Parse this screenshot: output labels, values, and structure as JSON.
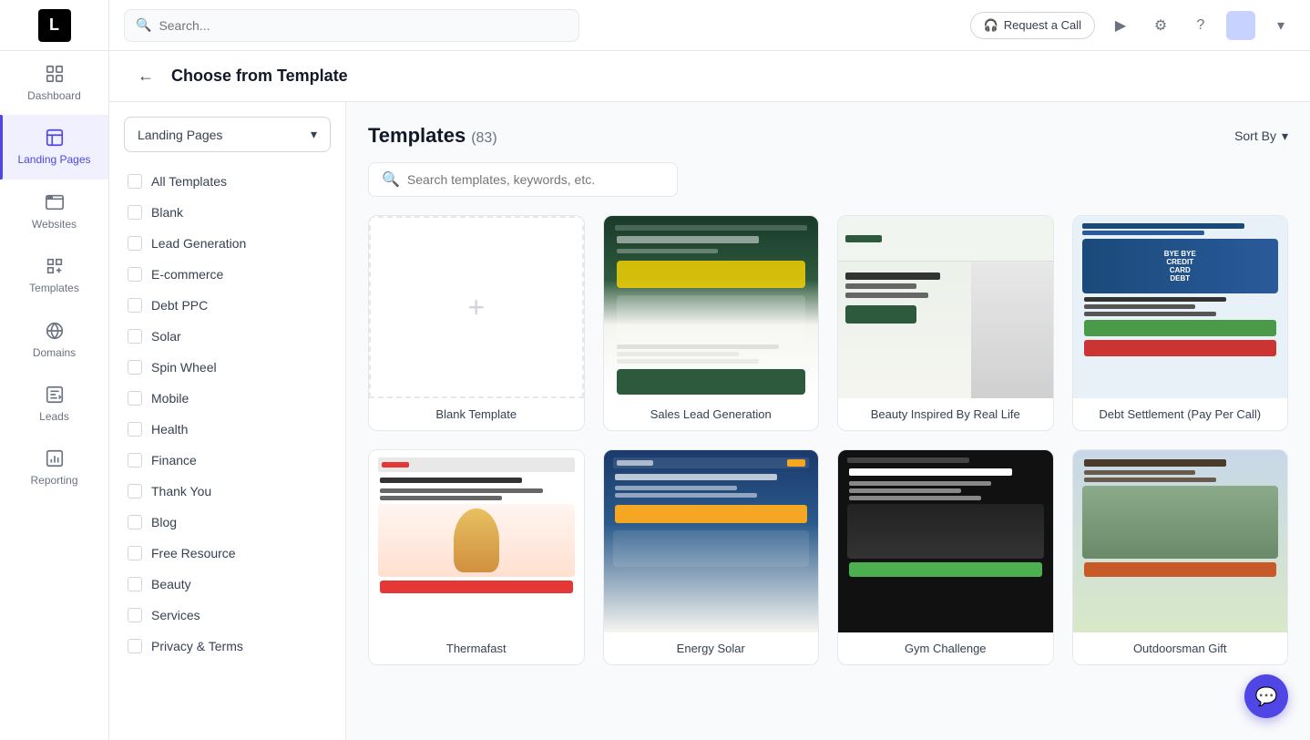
{
  "sidebar": {
    "logo_text": "L",
    "items": [
      {
        "id": "dashboard",
        "label": "Dashboard",
        "icon": "⊞",
        "active": false
      },
      {
        "id": "landing-pages",
        "label": "Landing Pages",
        "icon": "📄",
        "active": true
      },
      {
        "id": "websites",
        "label": "Websites",
        "icon": "🌐",
        "active": false
      },
      {
        "id": "templates",
        "label": "Templates",
        "icon": "🗂",
        "active": false
      },
      {
        "id": "domains",
        "label": "Domains",
        "icon": "🔗",
        "active": false
      },
      {
        "id": "leads",
        "label": "Leads",
        "icon": "📊",
        "active": false
      },
      {
        "id": "reporting",
        "label": "Reporting",
        "icon": "📈",
        "active": false
      }
    ]
  },
  "topbar": {
    "search_placeholder": "Search...",
    "request_call_label": "Request a Call",
    "icons": [
      "▶",
      "⚙",
      "?"
    ]
  },
  "page_header": {
    "back_label": "←",
    "title": "Choose from Template"
  },
  "filter_sidebar": {
    "dropdown_label": "Landing Pages",
    "filters": [
      {
        "id": "all",
        "label": "All Templates"
      },
      {
        "id": "blank",
        "label": "Blank"
      },
      {
        "id": "lead-gen",
        "label": "Lead Generation"
      },
      {
        "id": "ecommerce",
        "label": "E-commerce"
      },
      {
        "id": "debt-ppc",
        "label": "Debt PPC"
      },
      {
        "id": "solar",
        "label": "Solar"
      },
      {
        "id": "spin-wheel",
        "label": "Spin Wheel"
      },
      {
        "id": "mobile",
        "label": "Mobile"
      },
      {
        "id": "health",
        "label": "Health"
      },
      {
        "id": "finance",
        "label": "Finance"
      },
      {
        "id": "thank-you",
        "label": "Thank You"
      },
      {
        "id": "blog",
        "label": "Blog"
      },
      {
        "id": "free-resource",
        "label": "Free Resource"
      },
      {
        "id": "beauty",
        "label": "Beauty"
      },
      {
        "id": "services",
        "label": "Services"
      },
      {
        "id": "privacy-terms",
        "label": "Privacy & Terms"
      }
    ]
  },
  "templates_area": {
    "title": "Templates",
    "count": "(83)",
    "search_placeholder": "Search templates, keywords, etc.",
    "sort_label": "Sort By",
    "templates": [
      {
        "id": "blank",
        "name": "Blank Template",
        "preview_type": "blank"
      },
      {
        "id": "sales-lead",
        "name": "Sales Lead Generation",
        "preview_type": "sales"
      },
      {
        "id": "beauty-real-life",
        "name": "Beauty Inspired By Real Life",
        "preview_type": "beauty"
      },
      {
        "id": "debt-settlement",
        "name": "Debt Settlement (Pay Per Call)",
        "preview_type": "debt"
      },
      {
        "id": "thermafast",
        "name": "Thermafast",
        "preview_type": "thermo"
      },
      {
        "id": "energy-solar",
        "name": "Energy Solar",
        "preview_type": "energy"
      },
      {
        "id": "gym-challenge",
        "name": "Gym Challenge",
        "preview_type": "gym"
      },
      {
        "id": "outdoorsman",
        "name": "Outdoorsman Gift",
        "preview_type": "outdoor"
      }
    ]
  },
  "chat_bubble": {
    "icon": "💬"
  }
}
